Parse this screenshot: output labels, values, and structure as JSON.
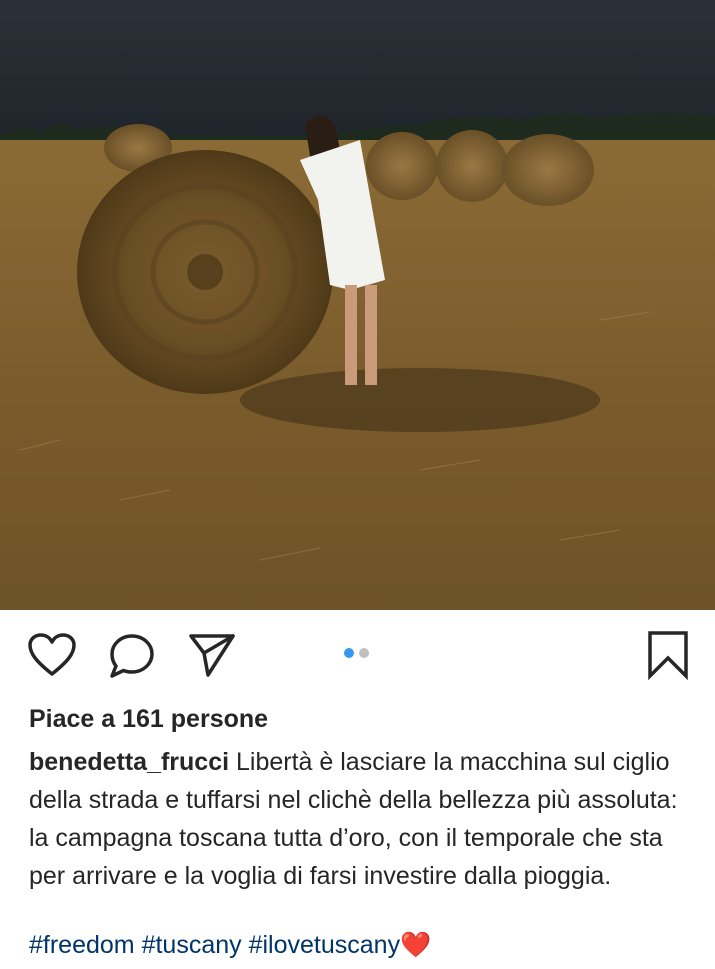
{
  "post": {
    "photo_alt": "",
    "carousel": {
      "count": 2,
      "active_index": 0
    },
    "likes_text": "Piace a 161 persone",
    "username": "benedetta_frucci",
    "caption": "Libertà è lasciare la macchina sul ciglio della strada e tuffarsi nel clichè della bellezza più assoluta: la campagna toscana tutta d’oro, con il temporale che sta per arrivare e la voglia di farsi investire dalla pioggia.",
    "hashtags": [
      "#freedom",
      "#tuscany",
      "#ilovetuscany"
    ],
    "trailing_emoji": "❤️"
  },
  "icons": {
    "like": "heart-outline-icon",
    "comment": "comment-bubble-icon",
    "share": "paper-plane-icon",
    "save": "bookmark-icon"
  },
  "colors": {
    "text": "#262626",
    "hashtag": "#003569",
    "carousel_active": "#3897f0",
    "carousel_inactive": "#c0c0c0",
    "sky": "#2a3038",
    "field": "#8a6a34"
  }
}
